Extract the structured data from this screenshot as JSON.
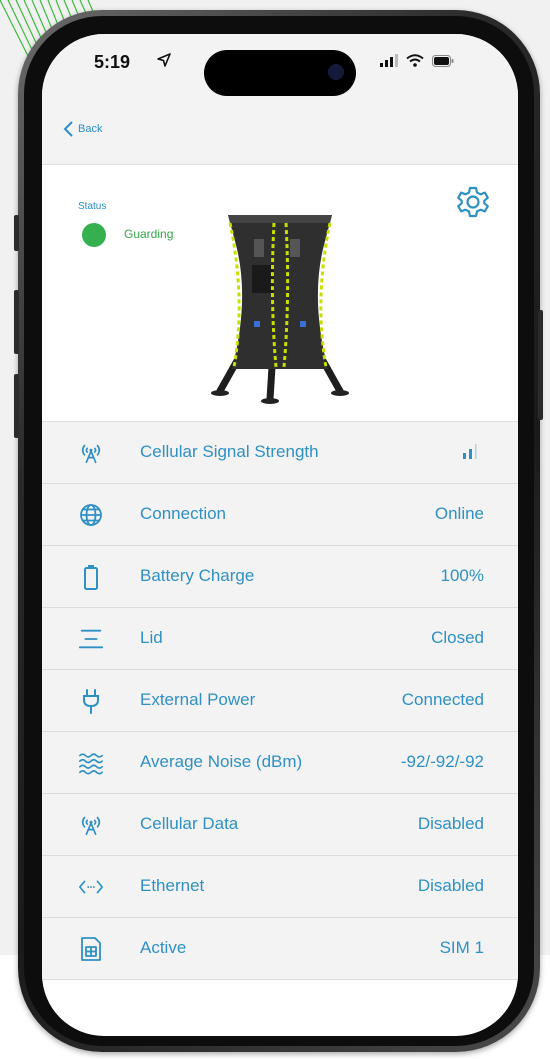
{
  "status_bar": {
    "time": "5:19"
  },
  "nav": {
    "back_label": "Back"
  },
  "device": {
    "status_label": "Status",
    "status_text": "Guarding",
    "status_color": "#35b04f"
  },
  "accent_color": "#2f90c4",
  "rows": [
    {
      "icon": "antenna-icon",
      "label": "Cellular Signal Strength",
      "value": "",
      "signal_bars_active": 2
    },
    {
      "icon": "globe-icon",
      "label": "Connection",
      "value": "Online"
    },
    {
      "icon": "battery-icon",
      "label": "Battery Charge",
      "value": "100%"
    },
    {
      "icon": "lid-icon",
      "label": "Lid",
      "value": "Closed"
    },
    {
      "icon": "plug-icon",
      "label": "External Power",
      "value": "Connected"
    },
    {
      "icon": "waves-icon",
      "label": "Average Noise (dBm)",
      "value": "-92/-92/-92"
    },
    {
      "icon": "antenna-icon",
      "label": "Cellular Data",
      "value": "Disabled"
    },
    {
      "icon": "code-icon",
      "label": "Ethernet",
      "value": "Disabled"
    },
    {
      "icon": "sim-card-icon",
      "label": "Active",
      "value": "SIM 1"
    }
  ]
}
